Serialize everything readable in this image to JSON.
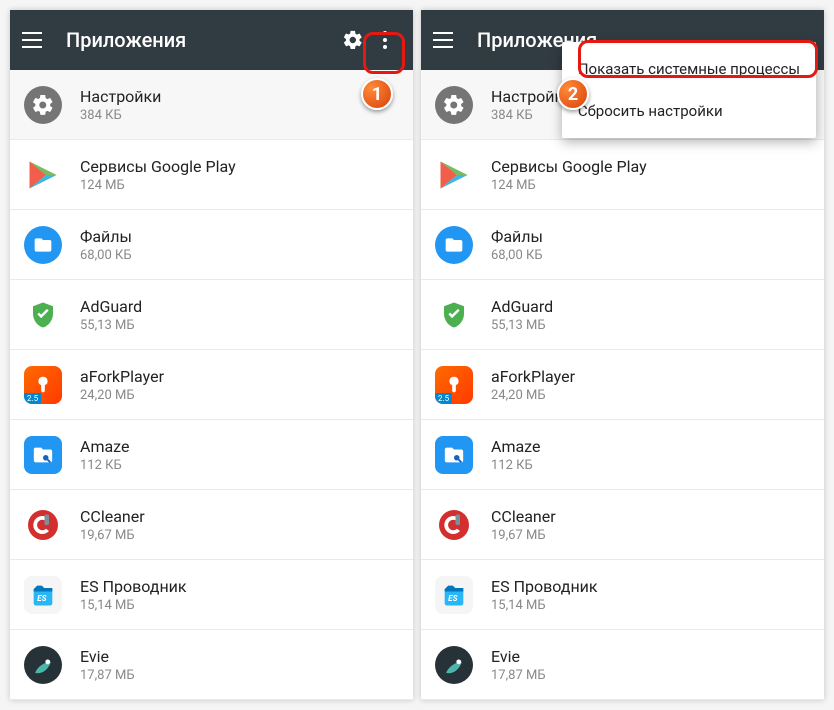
{
  "appbar": {
    "title": "Приложения"
  },
  "apps": [
    {
      "name": "Настройки",
      "size": "384 КБ"
    },
    {
      "name": "Сервисы Google Play",
      "size": "124 МБ"
    },
    {
      "name": "Файлы",
      "size": "68,00 КБ"
    },
    {
      "name": "AdGuard",
      "size": "55,13 МБ"
    },
    {
      "name": "aForkPlayer",
      "size": "24,20 МБ"
    },
    {
      "name": "Amaze",
      "size": "112 КБ"
    },
    {
      "name": "CCleaner",
      "size": "19,67 МБ"
    },
    {
      "name": "ES Проводник",
      "size": "15,14 МБ"
    },
    {
      "name": "Evie",
      "size": "17,87 МБ"
    }
  ],
  "popup": {
    "item1": "Показать системные процессы",
    "item2": "Сбросить настройки"
  },
  "badges": {
    "one": "1",
    "two": "2"
  },
  "fork_badge": "2.5"
}
